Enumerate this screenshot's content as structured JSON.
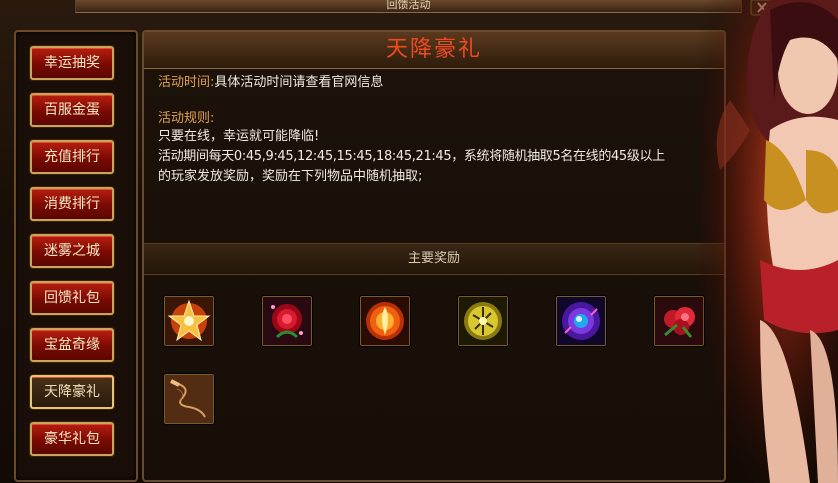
{
  "window": {
    "title": "回馈活动"
  },
  "nav": {
    "items": [
      {
        "label": "幸运抽奖",
        "active": false
      },
      {
        "label": "百服金蛋",
        "active": false
      },
      {
        "label": "充值排行",
        "active": false
      },
      {
        "label": "消费排行",
        "active": false
      },
      {
        "label": "迷雾之城",
        "active": false
      },
      {
        "label": "回馈礼包",
        "active": false
      },
      {
        "label": "宝盆奇缘",
        "active": false
      },
      {
        "label": "天降豪礼",
        "active": true
      },
      {
        "label": "豪华礼包",
        "active": false
      }
    ]
  },
  "panel": {
    "title": "天降豪礼",
    "time_label": "活动时间:",
    "time_value": "具体活动时间请查看官网信息",
    "rules_label": "活动规则:",
    "rules": [
      "只要在线，幸运就可能降临!",
      "活动期间每天0:45,9:45,12:45,15:45,18:45,21:45，系统将随机抽取5名在线的45级以上",
      "的玩家发放奖励，奖励在下列物品中随机抽取;"
    ],
    "rewards_header": "主要奖励",
    "rewards": [
      {
        "icon": "flame-star-icon"
      },
      {
        "icon": "red-rose-icon"
      },
      {
        "icon": "fire-orb-icon"
      },
      {
        "icon": "golden-orb-icon"
      },
      {
        "icon": "blue-gem-icon"
      },
      {
        "icon": "rose-bouquet-icon"
      },
      {
        "icon": "whip-icon"
      }
    ]
  },
  "colors": {
    "title": "#f04a20",
    "label": "#e0a24a",
    "button": "#a0140a",
    "border": "#c9a45a"
  }
}
